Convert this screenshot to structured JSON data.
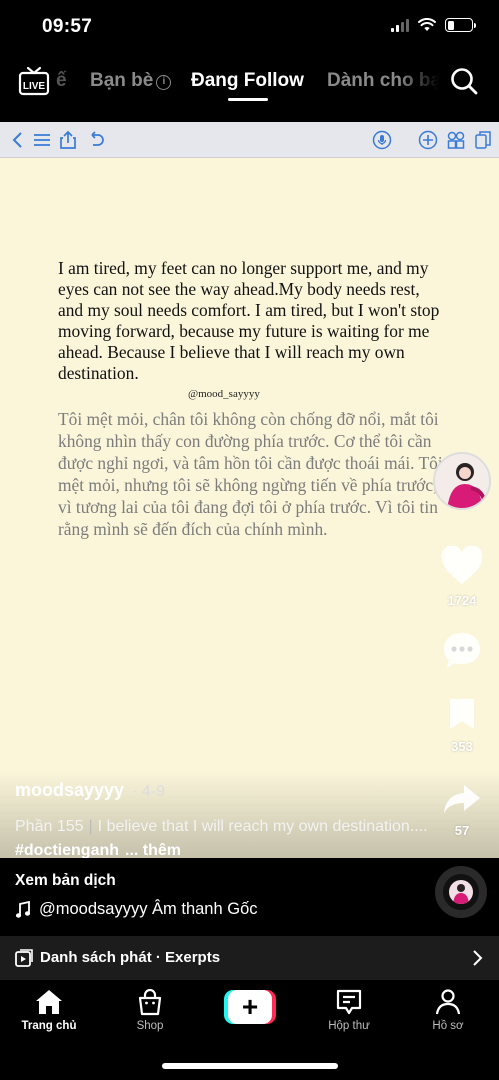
{
  "status_bar": {
    "time": "09:57"
  },
  "top_nav": {
    "live_label": "LIVE",
    "tabs": [
      {
        "label": "Bạn bè",
        "active": false
      },
      {
        "label": "Đang Follow",
        "active": true
      },
      {
        "label": "Dành cho bạn",
        "active": false
      }
    ]
  },
  "video": {
    "paragraph_en": "I am tired, my feet can no longer support me, and my eyes can not see the way ahead.My body needs rest, and my soul needs comfort. I am tired, but I won't stop moving forward, because my future is waiting for me ahead. Because I believe that I will reach my own destination.",
    "handle": "@mood_sayyyy",
    "paragraph_vi": "Tôi mệt mỏi, chân tôi không còn chống đỡ nổi, mắt tôi không nhìn thấy con đường phía trước. Cơ thể tôi cần được nghỉ ngơi, và tâm hồn tôi cần được thoái mái. Tôi mệt mỏi, nhưng tôi sẽ không ngừng tiến về phía trước, vì tương lai của tôi đang đợi tôi ở phía trước. Vì tôi tin rằng mình sẽ đến đích của chính mình."
  },
  "actions": {
    "likes": "1724",
    "saves": "353",
    "shares": "57"
  },
  "post": {
    "author": "moodsayyyy",
    "date": "· 4-9",
    "caption_part": "Phần 155",
    "caption_text": "I believe that I will reach my own destination....",
    "hashtag": "#doctienganh",
    "more": "... thêm"
  },
  "translate_label": "Xem bản dịch",
  "sound_label": "@moodsayyyy Âm thanh Gốc",
  "playlist_label": "Danh sách phát · Exerpts",
  "bottom_nav": {
    "home": "Trang chủ",
    "shop": "Shop",
    "inbox": "Hộp thư",
    "profile": "Hồ sơ"
  },
  "colors": {
    "video_bg": "#fbf6da",
    "toolbar_bg": "#e6e7ec",
    "accent_cyan": "#25f4ee",
    "accent_red": "#fe2c55",
    "toolbar_icon": "#3a7bd5"
  }
}
